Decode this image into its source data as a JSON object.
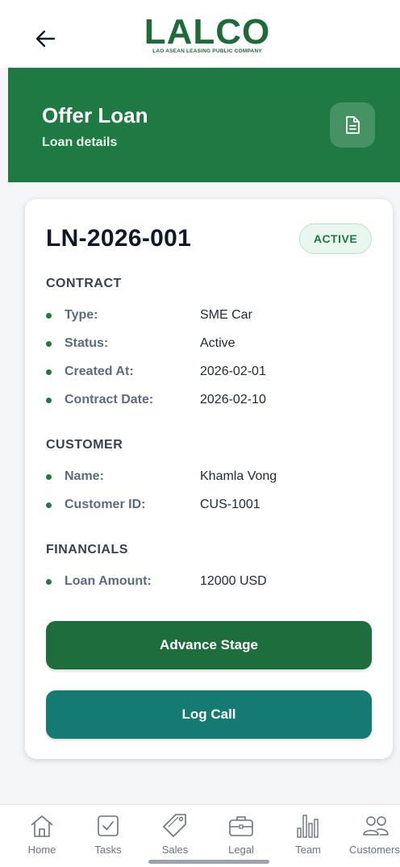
{
  "brand": {
    "name": "LALCO",
    "tagline": "LAO ASEAN LEASING PUBLIC COMPANY",
    "color": "#1e6b3a"
  },
  "header": {
    "title": "Offer Loan",
    "subtitle": "Loan details",
    "background": "#1e7a42"
  },
  "loan": {
    "id": "LN-2026-001",
    "status_badge": "ACTIVE"
  },
  "sections": {
    "contract": {
      "title": "CONTRACT",
      "rows": [
        {
          "label": "Type:",
          "value": "SME Car"
        },
        {
          "label": "Status:",
          "value": "Active"
        },
        {
          "label": "Created At:",
          "value": "2026-02-01"
        },
        {
          "label": "Contract Date:",
          "value": "2026-02-10"
        }
      ]
    },
    "customer": {
      "title": "CUSTOMER",
      "rows": [
        {
          "label": "Name:",
          "value": "Khamla Vong"
        },
        {
          "label": "Customer ID:",
          "value": "CUS-1001"
        }
      ]
    },
    "financials": {
      "title": "FINANCIALS",
      "rows": [
        {
          "label": "Loan Amount:",
          "value": "12000 USD"
        }
      ]
    }
  },
  "actions": {
    "advance_label": "Advance Stage",
    "log_call_label": "Log Call"
  },
  "nav": {
    "items": [
      {
        "label": "Home",
        "icon": "home-icon"
      },
      {
        "label": "Tasks",
        "icon": "checkbox-icon"
      },
      {
        "label": "Sales",
        "icon": "tag-icon"
      },
      {
        "label": "Legal",
        "icon": "briefcase-icon"
      },
      {
        "label": "Team",
        "icon": "bar-chart-icon"
      },
      {
        "label": "Customers",
        "icon": "users-icon"
      }
    ]
  }
}
